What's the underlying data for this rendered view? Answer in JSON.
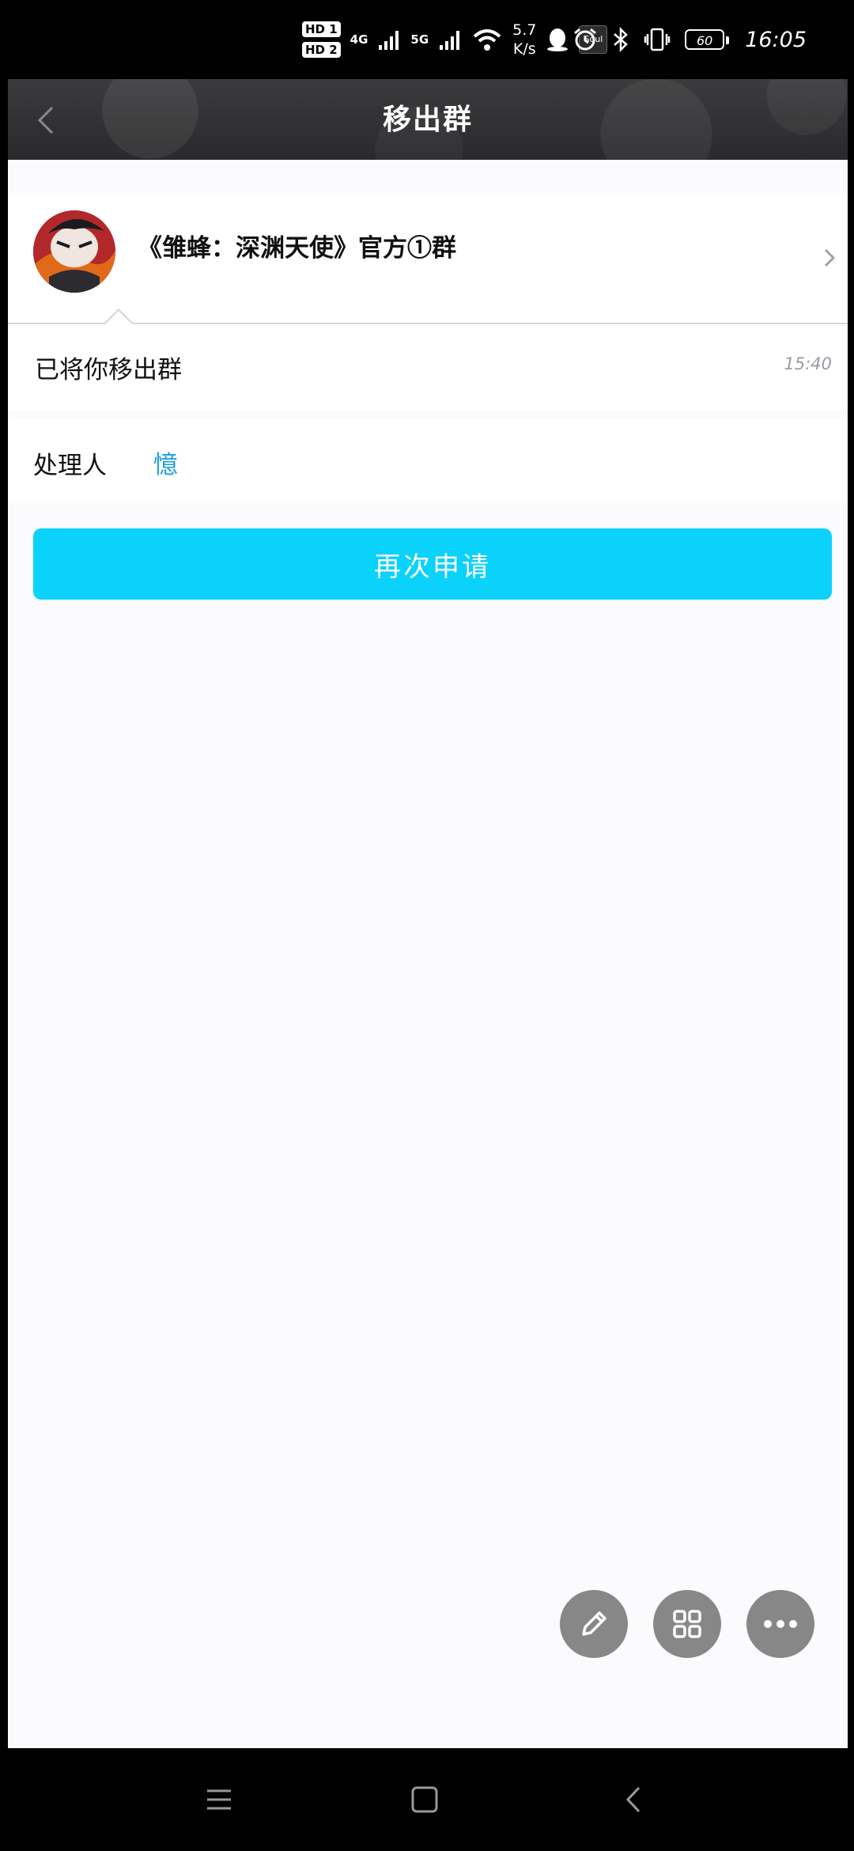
{
  "status_bar": {
    "hd1": "HD 1",
    "hd2": "HD 2",
    "net1": "4G",
    "net2": "5G",
    "speed_value": "5.7",
    "speed_unit": "K/s",
    "soul_label": "Soul",
    "battery": "60",
    "time": "16:05",
    "icons": [
      "signal-icon",
      "wifi-icon",
      "qq-icon",
      "soul-app-icon",
      "alarm-icon",
      "bluetooth-icon",
      "vibrate-icon",
      "battery-icon"
    ]
  },
  "header": {
    "title": "移出群",
    "back_icon": "chevron-left-icon"
  },
  "group": {
    "name": "《雏蜂：深渊天使》官方①群",
    "avatar_icon": "group-avatar",
    "chevron_icon": "chevron-right-icon"
  },
  "message": {
    "text": "已将你移出群",
    "time": "15:40"
  },
  "handler": {
    "label": "处理人",
    "name": "憶"
  },
  "reapply_button": {
    "label": "再次申请",
    "color": "#0ad2fb"
  },
  "floating_actions": [
    {
      "icon": "pencil-icon"
    },
    {
      "icon": "grid-icon"
    },
    {
      "icon": "more-icon"
    }
  ],
  "nav_bar": {
    "icons": [
      "menu-icon",
      "home-icon",
      "back-icon"
    ]
  },
  "colors": {
    "accent": "#0ad2fb",
    "link": "#1d9bdc",
    "header_bg": "#333335"
  }
}
